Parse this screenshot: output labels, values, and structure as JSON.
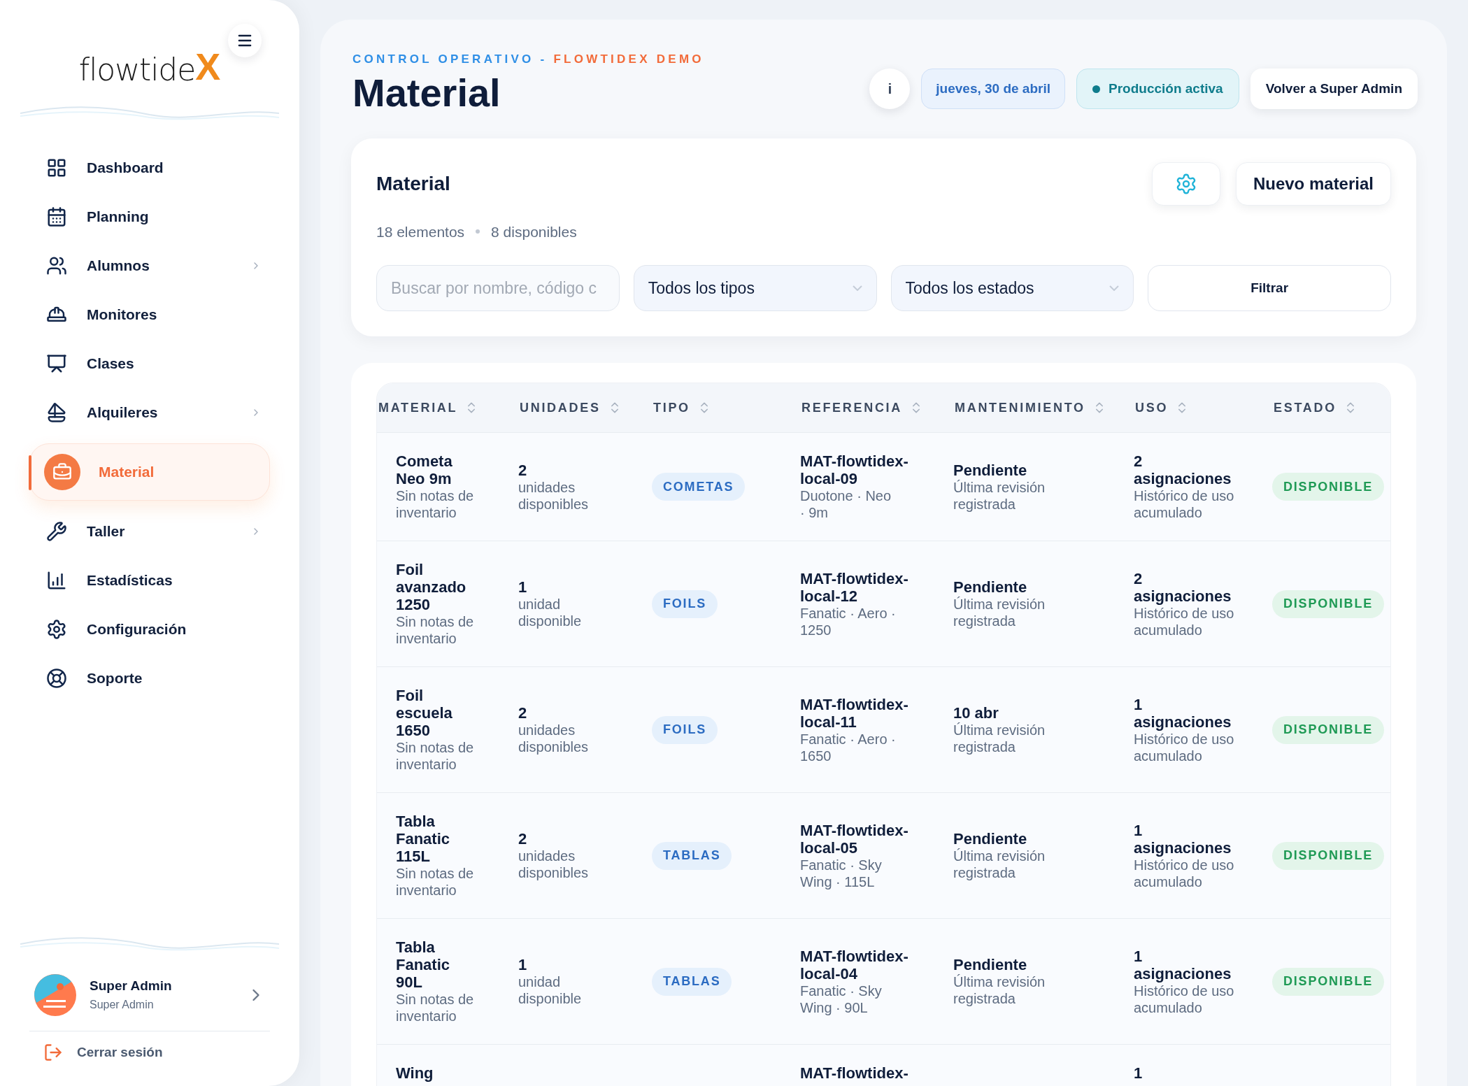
{
  "sidebar": {
    "logo": {
      "text": "flowtide",
      "accent": "X"
    },
    "items": [
      {
        "label": "Dashboard",
        "selected": false,
        "has_submenu": false
      },
      {
        "label": "Planning",
        "selected": false,
        "has_submenu": false
      },
      {
        "label": "Alumnos",
        "selected": false,
        "has_submenu": true
      },
      {
        "label": "Monitores",
        "selected": false,
        "has_submenu": false
      },
      {
        "label": "Clases",
        "selected": false,
        "has_submenu": false
      },
      {
        "label": "Alquileres",
        "selected": false,
        "has_submenu": true
      },
      {
        "label": "Material",
        "selected": true,
        "has_submenu": false
      },
      {
        "label": "Taller",
        "selected": false,
        "has_submenu": true
      },
      {
        "label": "Estadísticas",
        "selected": false,
        "has_submenu": false
      },
      {
        "label": "Configuración",
        "selected": false,
        "has_submenu": false
      },
      {
        "label": "Soporte",
        "selected": false,
        "has_submenu": false
      }
    ],
    "user": {
      "name": "Super Admin",
      "role": "Super Admin"
    },
    "logout": "Cerrar sesión"
  },
  "header": {
    "eyebrow": "CONTROL OPERATIVO - ",
    "eyebrow_accent": "FLOWTIDEX DEMO",
    "title": "Material",
    "info_button": "i",
    "date": "jueves, 30 de abril",
    "status": "Producción activa",
    "back_button": "Volver a Super Admin"
  },
  "panel": {
    "title": "Material",
    "count": "18 elementos",
    "available": "8 disponibles",
    "new_button": "Nuevo material",
    "search": {
      "placeholder": "Buscar por nombre, código c"
    },
    "type_filter": "Todos los tipos",
    "state_filter": "Todos los estados",
    "filter_button": "Filtrar"
  },
  "table": {
    "columns": [
      "MATERIAL",
      "UNIDADES",
      "TIPO",
      "REFERENCIA",
      "MANTENIMIENTO",
      "USO",
      "ESTADO"
    ],
    "rows": [
      {
        "material": "Cometa Neo 9m",
        "notes": "Sin notas de inventario",
        "units": "2",
        "units_label": "unidades disponibles",
        "type": "COMETAS",
        "reference": "MAT-flowtidex-local-09",
        "reference_detail": "Duotone · Neo · 9m",
        "maintenance": "Pendiente",
        "maintenance_note": "Última revisión registrada",
        "usage": "2 asignaciones",
        "usage_note": "Histórico de uso acumulado",
        "status": "DISPONIBLE"
      },
      {
        "material": "Foil avanzado 1250",
        "notes": "Sin notas de inventario",
        "units": "1",
        "units_label": "unidad disponible",
        "type": "FOILS",
        "reference": "MAT-flowtidex-local-12",
        "reference_detail": "Fanatic · Aero · 1250",
        "maintenance": "Pendiente",
        "maintenance_note": "Última revisión registrada",
        "usage": "2 asignaciones",
        "usage_note": "Histórico de uso acumulado",
        "status": "DISPONIBLE"
      },
      {
        "material": "Foil escuela 1650",
        "notes": "Sin notas de inventario",
        "units": "2",
        "units_label": "unidades disponibles",
        "type": "FOILS",
        "reference": "MAT-flowtidex-local-11",
        "reference_detail": "Fanatic · Aero · 1650",
        "maintenance": "10 abr",
        "maintenance_note": "Última revisión registrada",
        "usage": "1 asignaciones",
        "usage_note": "Histórico de uso acumulado",
        "status": "DISPONIBLE"
      },
      {
        "material": "Tabla Fanatic 115L",
        "notes": "Sin notas de inventario",
        "units": "2",
        "units_label": "unidades disponibles",
        "type": "TABLAS",
        "reference": "MAT-flowtidex-local-05",
        "reference_detail": "Fanatic · Sky Wing · 115L",
        "maintenance": "Pendiente",
        "maintenance_note": "Última revisión registrada",
        "usage": "1 asignaciones",
        "usage_note": "Histórico de uso acumulado",
        "status": "DISPONIBLE"
      },
      {
        "material": "Tabla Fanatic 90L",
        "notes": "Sin notas de inventario",
        "units": "1",
        "units_label": "unidad disponible",
        "type": "TABLAS",
        "reference": "MAT-flowtidex-local-04",
        "reference_detail": "Fanatic · Sky Wing · 90L",
        "maintenance": "Pendiente",
        "maintenance_note": "Última revisión registrada",
        "usage": "1 asignaciones",
        "usage_note": "Histórico de uso acumulado",
        "status": "DISPONIBLE"
      },
      {
        "material": "Wing",
        "reference": "MAT-flowtidex-",
        "usage": "1"
      }
    ]
  }
}
